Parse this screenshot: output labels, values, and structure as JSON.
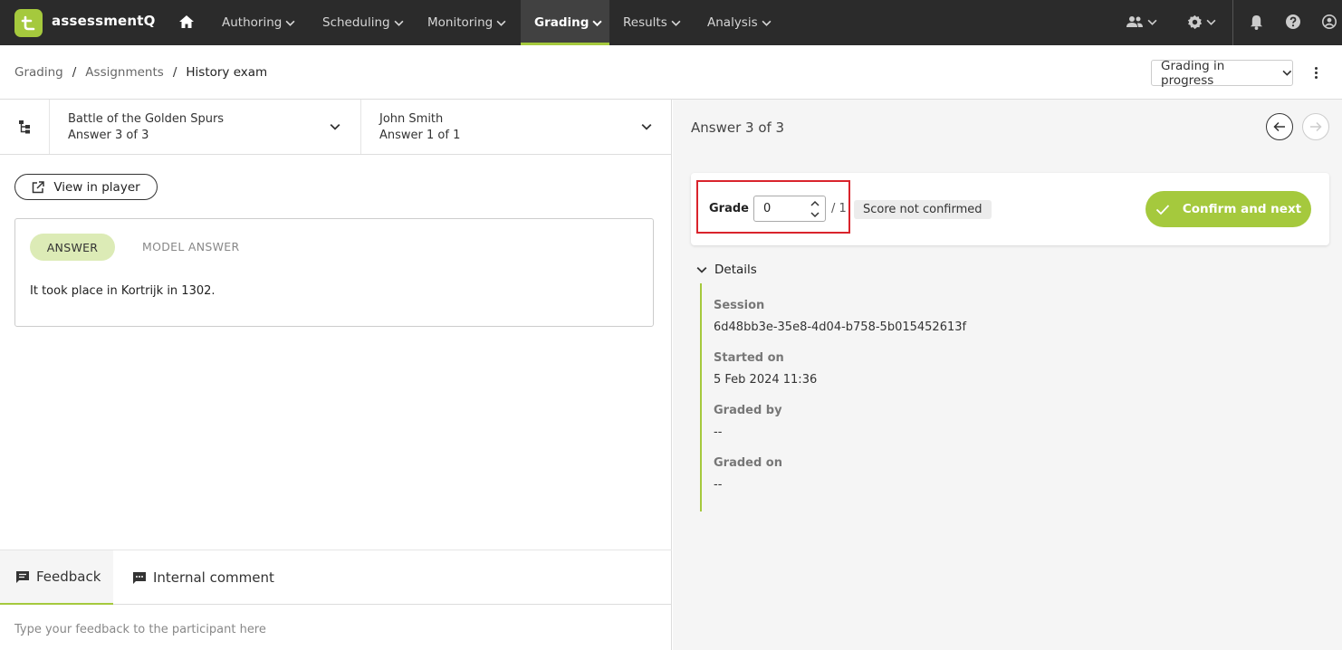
{
  "app": {
    "name": "assessmentQ",
    "brand_color": "#a5c93d"
  },
  "nav": {
    "items": [
      {
        "label": "Authoring"
      },
      {
        "label": "Scheduling"
      },
      {
        "label": "Monitoring"
      },
      {
        "label": "Grading",
        "active": true
      },
      {
        "label": "Results"
      },
      {
        "label": "Analysis"
      }
    ],
    "right_icons": [
      "users-icon",
      "gear-icon",
      "bell-icon",
      "help-icon",
      "user-icon"
    ]
  },
  "breadcrumb": {
    "items": [
      "Grading",
      "Assignments",
      "History exam"
    ]
  },
  "status_select": {
    "value": "Grading in progress"
  },
  "question_selector": {
    "title": "Battle of the Golden Spurs",
    "subtitle": "Answer 3 of 3"
  },
  "participant_selector": {
    "title": "John Smith",
    "subtitle": "Answer 1 of 1"
  },
  "view_in_player": {
    "label": "View in player"
  },
  "answer_tabs": {
    "answer": "ANSWER",
    "model": "MODEL ANSWER"
  },
  "answer_text": "It took place in Kortrijk in 1302.",
  "feedback_tabs": {
    "feedback": "Feedback",
    "internal": "Internal comment"
  },
  "feedback_placeholder": "Type your feedback to the participant here",
  "right": {
    "answer_count": "Answer 3 of 3",
    "grade_label": "Grade",
    "grade_value": "0",
    "grade_max": "/ 1",
    "score_status": "Score not confirmed",
    "confirm_label": "Confirm and next",
    "details_label": "Details",
    "details": [
      {
        "label": "Session",
        "value": "6d48bb3e-35e8-4d04-b758-5b015452613f"
      },
      {
        "label": "Started on",
        "value": "5 Feb 2024 11:36"
      },
      {
        "label": "Graded by",
        "value": "--"
      },
      {
        "label": "Graded on",
        "value": "--"
      }
    ]
  }
}
